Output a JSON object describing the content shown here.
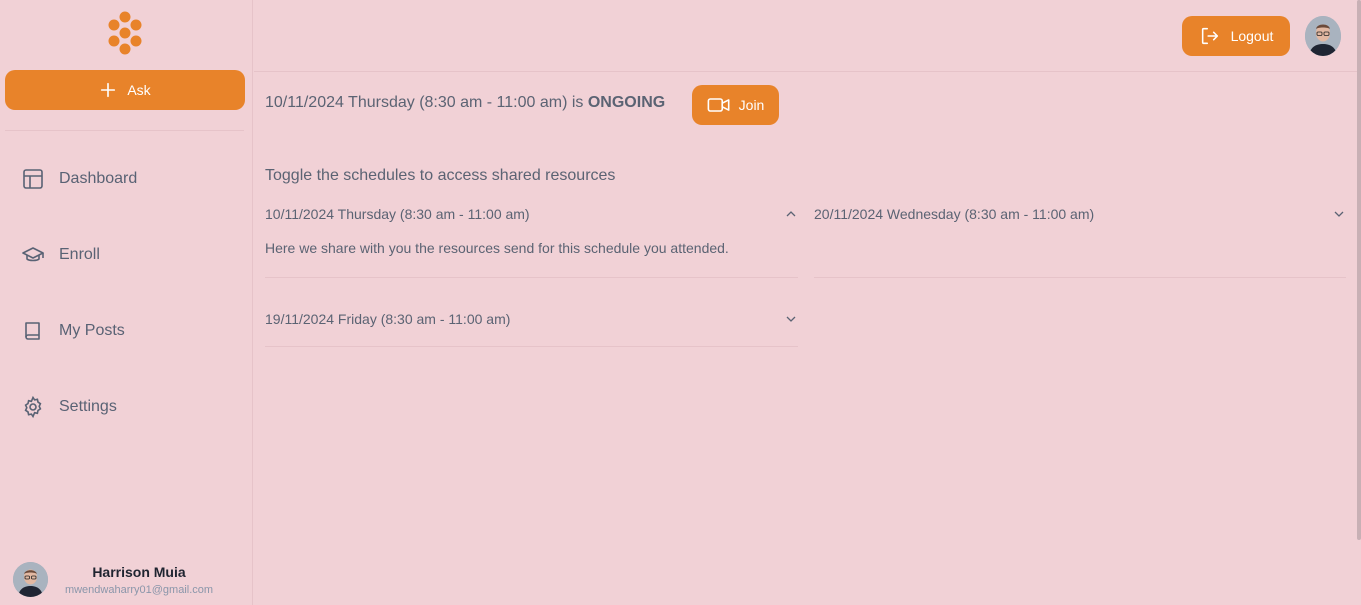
{
  "sidebar": {
    "ask_label": "Ask",
    "nav": [
      {
        "label": "Dashboard",
        "icon": "layout-icon"
      },
      {
        "label": "Enroll",
        "icon": "graduation-cap-icon"
      },
      {
        "label": "My Posts",
        "icon": "book-icon"
      },
      {
        "label": "Settings",
        "icon": "gear-icon"
      }
    ],
    "user": {
      "name": "Harrison Muia",
      "email": "mwendwaharry01@gmail.com"
    }
  },
  "header": {
    "logout_label": "Logout"
  },
  "main": {
    "status_prefix": "10/11/2024 Thursday (8:30 am - 11:00 am) is",
    "status_value": "ONGOING",
    "join_label": "Join",
    "section_title": "Toggle the schedules to access shared resources",
    "schedules": [
      {
        "label": "10/11/2024 Thursday (8:30 am - 11:00 am)",
        "expanded": true,
        "body": "Here we share with you the resources send for this schedule you attended."
      },
      {
        "label": "20/11/2024 Wednesday (8:30 am - 11:00 am)",
        "expanded": false
      },
      {
        "label": "19/11/2024 Friday (8:30 am - 11:00 am)",
        "expanded": false
      }
    ]
  },
  "colors": {
    "accent": "#e8832a",
    "background": "#f1d1d6",
    "text": "#5b6373"
  }
}
